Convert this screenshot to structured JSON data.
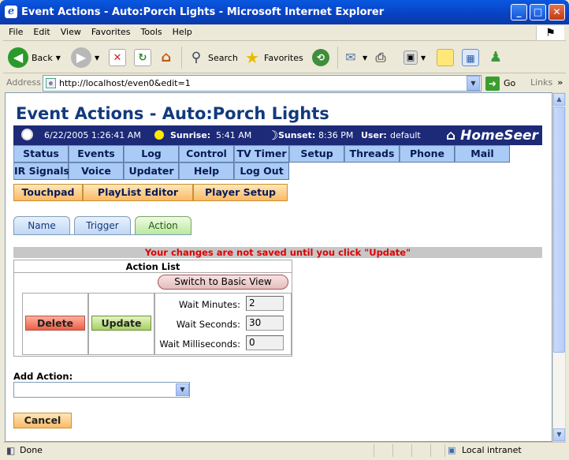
{
  "window": {
    "title": "Event Actions - Auto:Porch Lights - Microsoft Internet Explorer"
  },
  "menu": [
    "File",
    "Edit",
    "View",
    "Favorites",
    "Tools",
    "Help"
  ],
  "toolbar": {
    "back": "Back",
    "search": "Search",
    "favorites": "Favorites"
  },
  "address": {
    "label": "Address",
    "url": "http://localhost/even0&edit=1",
    "go": "Go",
    "links": "Links"
  },
  "page": {
    "title": "Event Actions - Auto:Porch Lights",
    "date": "6/22/2005 1:26:41 AM",
    "sunrise_label": "Sunrise:",
    "sunrise": "5:41 AM",
    "sunset_label": "Sunset:",
    "sunset": "8:36 PM",
    "user_label": "User:",
    "user": "default",
    "logo": "HomeSeer"
  },
  "nav_row1": [
    "Status",
    "Events",
    "Log",
    "Control",
    "TV Timer",
    "Setup",
    "Threads",
    "Phone",
    "Mail"
  ],
  "nav_row2": [
    "IR Signals",
    "Voice",
    "Updater",
    "Help",
    "Log Out"
  ],
  "nav_row3": [
    "Touchpad",
    "PlayList Editor",
    "Player Setup"
  ],
  "tabs": [
    "Name",
    "Trigger",
    "Action"
  ],
  "warning": "Your changes are not saved until you click \"Update\"",
  "action_list": {
    "header": "Action List",
    "switch_view": "Switch to Basic View",
    "delete": "Delete",
    "update": "Update",
    "wait_minutes_label": "Wait Minutes:",
    "wait_minutes": "2",
    "wait_seconds_label": "Wait Seconds:",
    "wait_seconds": "30",
    "wait_ms_label": "Wait Milliseconds:",
    "wait_ms": "0"
  },
  "add_action": {
    "label": "Add Action:",
    "value": ""
  },
  "cancel": "Cancel",
  "status": {
    "text": "Done",
    "zone": "Local intranet"
  }
}
